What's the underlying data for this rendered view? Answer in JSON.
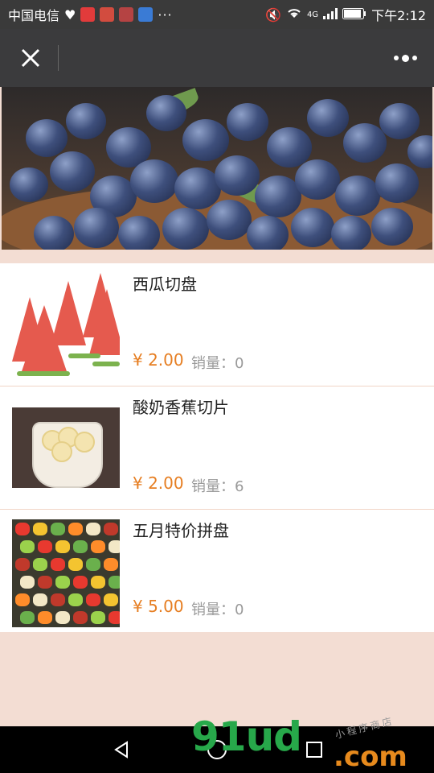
{
  "status_bar": {
    "carrier": "中国电信",
    "network": "4G",
    "time": "下午2:12",
    "more": "···"
  },
  "titlebar": {
    "close_icon": "close-icon",
    "more_icon": "more-icon"
  },
  "products": [
    {
      "name": "西瓜切盘",
      "price": "¥ 2.00",
      "sales": "销量：0",
      "image": "watermelon"
    },
    {
      "name": "酸奶香蕉切片",
      "price": "¥ 2.00",
      "sales": "销量：6",
      "image": "yogurt-banana"
    },
    {
      "name": "五月特价拼盘",
      "price": "¥ 5.00",
      "sales": "销量：0",
      "image": "fruit-platter"
    }
  ],
  "watermark": {
    "main": "91ud",
    "domain": ".com",
    "sub": "小程序商店"
  },
  "colors": {
    "price": "#e67e22",
    "page_bg": "#f3ddd3",
    "titlebar": "#3b3b3d"
  }
}
